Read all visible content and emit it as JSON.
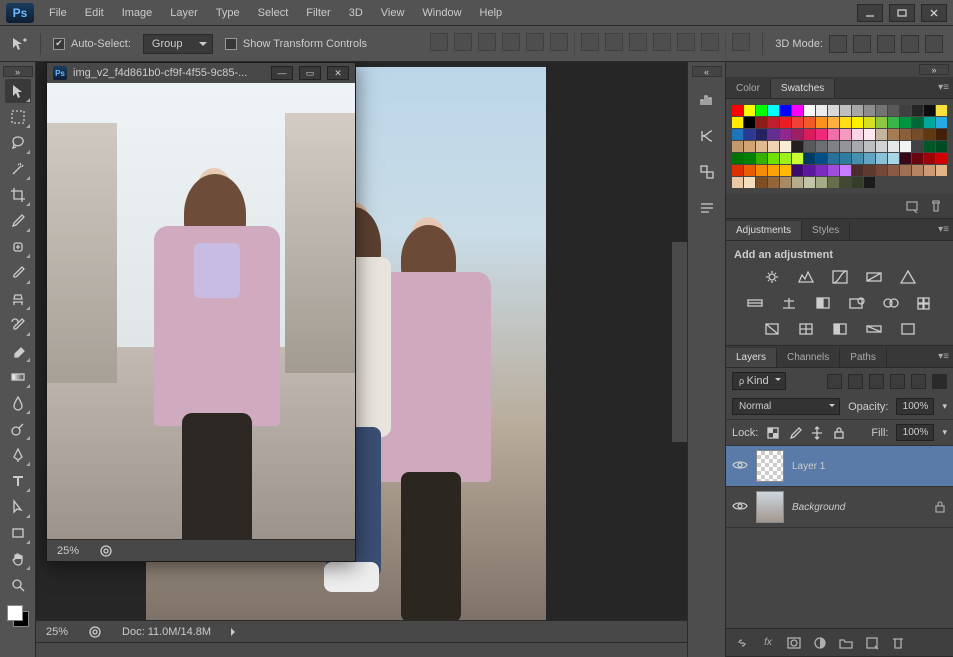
{
  "app_logo": "Ps",
  "menu": [
    "File",
    "Edit",
    "Image",
    "Layer",
    "Type",
    "Select",
    "Filter",
    "3D",
    "View",
    "Window",
    "Help"
  ],
  "window_controls": {
    "min": "minimize",
    "max": "maximize",
    "close": "close"
  },
  "options": {
    "auto_select_label": "Auto-Select:",
    "auto_select_checked": true,
    "group_label": "Group",
    "show_transform_label": "Show Transform Controls",
    "show_transform_checked": false,
    "mode3d_label": "3D Mode:"
  },
  "tools": [
    "move",
    "rect-marquee",
    "lasso",
    "magic-wand",
    "crop",
    "eyedropper",
    "healing-brush",
    "brush",
    "clone-stamp",
    "history-brush",
    "eraser",
    "gradient",
    "blur",
    "dodge",
    "pen",
    "type",
    "path-select",
    "rectangle",
    "hand",
    "zoom"
  ],
  "document": {
    "tab_title": "img_v2_f4d861b0-cf9f-4f55-9c85-...",
    "float_zoom": "25%",
    "main_zoom": "25%",
    "doc_size": "Doc: 11.0M/14.8M"
  },
  "panels": {
    "color_tabs": [
      "Color",
      "Swatches"
    ],
    "color_active": "Swatches",
    "swatch_colors": [
      "#ff0000",
      "#ffff00",
      "#00ff00",
      "#00ffff",
      "#0000ff",
      "#ff00ff",
      "#ffffff",
      "#ececec",
      "#d9d9d9",
      "#bfbfbf",
      "#a6a6a6",
      "#8c8c8c",
      "#737373",
      "#595959",
      "#404040",
      "#262626",
      "#0d0d0d",
      "#f7e33b",
      "#ffec00",
      "#000000",
      "#8c1d18",
      "#be1e2d",
      "#ed1c24",
      "#ef4136",
      "#f15a29",
      "#f7941e",
      "#fbb040",
      "#ffde17",
      "#fff200",
      "#d7df23",
      "#8dc63f",
      "#39b54a",
      "#009444",
      "#006838",
      "#00a79d",
      "#27aae1",
      "#1c75bc",
      "#2b3990",
      "#262262",
      "#662d91",
      "#92278f",
      "#9e1f63",
      "#da1c5c",
      "#ee2a7b",
      "#f06eaa",
      "#f49ac1",
      "#fbd5e5",
      "#fde8ef",
      "#c2b59b",
      "#a67c52",
      "#8b5e3c",
      "#754c29",
      "#603913",
      "#42210b",
      "#c49a6c",
      "#d4a373",
      "#e0b98e",
      "#edd3b1",
      "#faebd7",
      "#231f20",
      "#58595b",
      "#6d6e71",
      "#808285",
      "#939598",
      "#a7a9ac",
      "#bcbec0",
      "#d1d3d4",
      "#e6e7e8",
      "#f1f2f2",
      "#414042",
      "#005826",
      "#004b23",
      "#007200",
      "#008000",
      "#38b000",
      "#70e000",
      "#9ef01a",
      "#ccff33",
      "#013a63",
      "#014f86",
      "#2a6f97",
      "#2c7da0",
      "#468faf",
      "#61a5c2",
      "#89c2d9",
      "#a9d6e5",
      "#370617",
      "#6a040f",
      "#9d0208",
      "#d00000",
      "#dc2f02",
      "#e85d04",
      "#f48c06",
      "#faa307",
      "#ffba08",
      "#3c096c",
      "#5a189a",
      "#7b2cbf",
      "#9d4edd",
      "#c77dff",
      "#4a2c2a",
      "#5e3a2e",
      "#744838",
      "#8a5a44",
      "#a06e52",
      "#b68463",
      "#cc9b75",
      "#e2b48a",
      "#ebc9a4",
      "#f3dec0",
      "#7f4f24",
      "#936639",
      "#a68a64",
      "#b6ad90",
      "#c2c5aa",
      "#a4ac86",
      "#656d4a",
      "#414833",
      "#333d29",
      "#1b1b1b"
    ],
    "adjustments_tabs": [
      "Adjustments",
      "Styles"
    ],
    "adjustments_active": "Adjustments",
    "adjustments_title": "Add an adjustment",
    "layer_panel_tabs": [
      "Layers",
      "Channels",
      "Paths"
    ],
    "layer_panel_active": "Layers",
    "kind_label": "Kind",
    "blend_label": "Normal",
    "opacity_label": "Opacity:",
    "opacity_value": "100%",
    "lock_label": "Lock:",
    "fill_label": "Fill:",
    "fill_value": "100%",
    "layers": [
      {
        "name": "Layer 1",
        "selected": true,
        "locked": false,
        "visible": true,
        "bg": false
      },
      {
        "name": "Background",
        "selected": false,
        "locked": true,
        "visible": true,
        "bg": true
      }
    ]
  }
}
